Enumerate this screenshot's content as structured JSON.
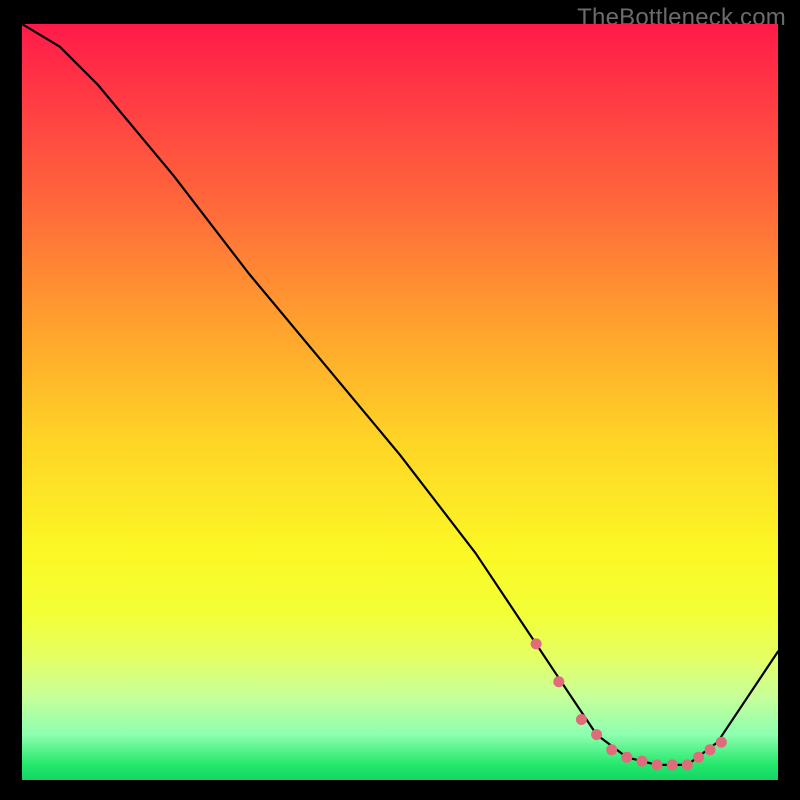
{
  "watermark": "TheBottleneck.com",
  "chart_data": {
    "type": "line",
    "title": "",
    "xlabel": "",
    "ylabel": "",
    "xlim": [
      0,
      100
    ],
    "ylim": [
      0,
      100
    ],
    "grid": false,
    "series": [
      {
        "name": "curve",
        "x": [
          0,
          5,
          10,
          20,
          30,
          40,
          50,
          60,
          68,
          72,
          76,
          80,
          84,
          88,
          92,
          100
        ],
        "y": [
          100,
          97,
          92,
          80,
          67,
          55,
          43,
          30,
          18,
          12,
          6,
          3,
          2,
          2,
          5,
          17
        ]
      }
    ],
    "markers": {
      "name": "highlight-dots",
      "color": "#e06b7a",
      "x": [
        68,
        71,
        74,
        76,
        78,
        80,
        82,
        84,
        86,
        88,
        89.5,
        91,
        92.5
      ],
      "y": [
        18,
        13,
        8,
        6,
        4,
        3,
        2.5,
        2,
        2,
        2,
        3,
        4,
        5
      ]
    }
  }
}
